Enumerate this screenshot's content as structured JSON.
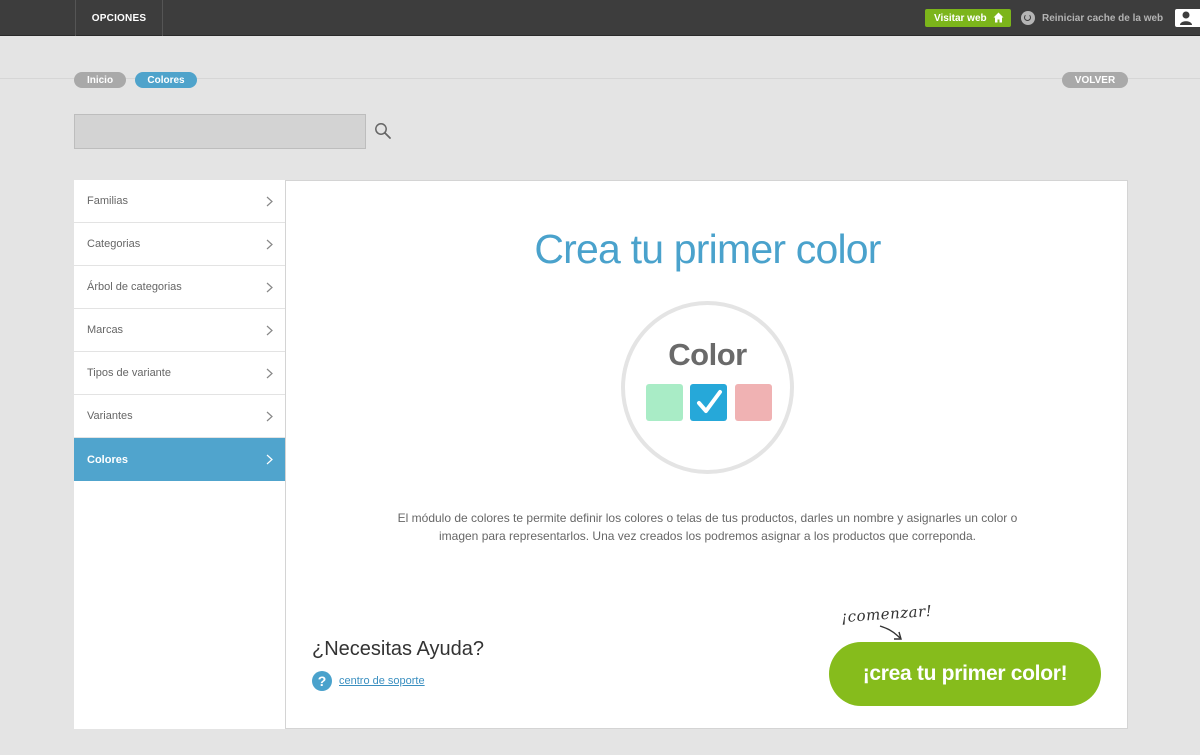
{
  "topbar": {
    "menu_label": "OPCIONES",
    "visit_label": "Visitar web",
    "cache_label": "Reiniciar cache de la web"
  },
  "breadcrumb": {
    "items": [
      "Inicio",
      "Colores"
    ],
    "back_label": "VOLVER"
  },
  "search": {
    "value": "",
    "placeholder": ""
  },
  "sidebar": {
    "items": [
      {
        "label": "Familias",
        "active": false
      },
      {
        "label": "Categorias",
        "active": false
      },
      {
        "label": "Árbol de categorias",
        "active": false
      },
      {
        "label": "Marcas",
        "active": false
      },
      {
        "label": "Tipos de variante",
        "active": false
      },
      {
        "label": "Variantes",
        "active": false
      },
      {
        "label": "Colores",
        "active": true
      }
    ]
  },
  "main": {
    "title": "Crea tu primer color",
    "illustration_word": "Color",
    "description": "El módulo de colores te permite definir los colores o telas de tus productos, darles un nombre y asignarles un color o imagen para representarlos. Una vez creados los podremos asignar a los productos que correponda.",
    "help_title": "¿Necesitas Ayuda?",
    "help_icon_glyph": "?",
    "help_link": "centro de soporte",
    "start_note": "¡comenzar!",
    "cta_label": "¡crea tu primer color!"
  },
  "colors": {
    "accent_blue": "#4fa3cb",
    "accent_green": "#86bc1c",
    "topbar_bg": "#3d3d3d",
    "swatch_green": "#a9ecc6",
    "swatch_blue": "#26a8d9",
    "swatch_pink": "#f0b2b3"
  },
  "icons": {
    "visit": "home-icon",
    "cache": "refresh-icon",
    "user": "user-icon",
    "search": "search-icon",
    "sidebar": "chevron-right-icon",
    "help": "question-circle-icon",
    "check": "checkmark-icon"
  }
}
